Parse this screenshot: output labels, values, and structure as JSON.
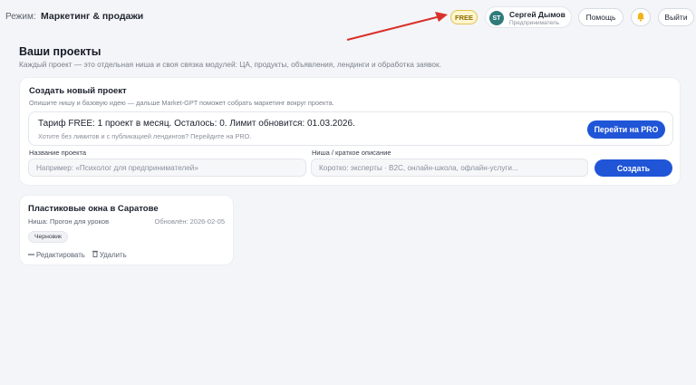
{
  "header": {
    "mode_label": "Режим:",
    "mode_value": "Маркетинг & продажи",
    "plan_badge": "FREE",
    "user": {
      "initials": "ST",
      "name": "Сергей Дымов",
      "role": "Предприниматель"
    },
    "help_label": "Помощь",
    "logout_label": "Выйти"
  },
  "page": {
    "title": "Ваши проекты",
    "subtitle": "Каждый проект — это отдельная ниша и своя связка модулей: ЦА, продукты, объявления, лендинги и обработка заявок."
  },
  "create": {
    "title": "Создать новый проект",
    "subtitle": "Опишите нишу и базовую идею — дальше Market-GPT поможет собрать маркетинг вокруг проекта.",
    "tariff_main": "Тариф FREE: 1 проект в месяц. Осталось: 0. Лимит обновится: 01.03.2026.",
    "tariff_sub": "Хотите без лимитов и с публикацией лендингов? Перейдите на PRO.",
    "pro_button": "Перейти на PRO",
    "name_label": "Название проекта",
    "name_placeholder": "Например: «Психолог для предпринимателей»",
    "niche_label": "Ниша / краткое описание",
    "niche_placeholder": "Коротко: эксперты · B2C, онлайн-школа, офлайн-услуги...",
    "create_button": "Создать"
  },
  "projects": [
    {
      "title": "Пластиковые окна в Саратове",
      "niche": "Ниша: Прогон для уроков",
      "updated": "Обновлён: 2026-02-05",
      "status": "Черновик",
      "edit_label": "Редактировать",
      "delete_label": "Удалить"
    }
  ],
  "icons": {
    "bell": "bell-icon",
    "edit": "edit-icon",
    "delete": "trash-icon"
  },
  "colors": {
    "accent": "#1f55d6",
    "free_badge_bg": "#fff6cf",
    "avatar": "#2f7b7b",
    "annotation_arrow": "#d9302c"
  }
}
